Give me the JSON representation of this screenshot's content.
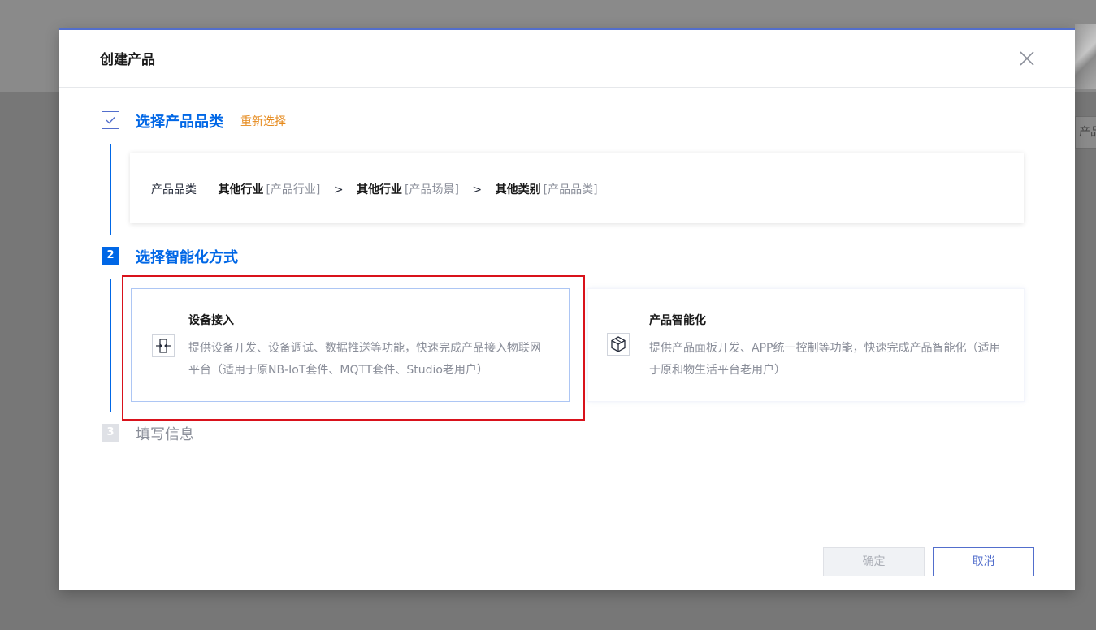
{
  "background": {
    "top_text": "",
    "right_tab_label": "产品"
  },
  "modal": {
    "title": "创建产品"
  },
  "steps": [
    {
      "number": "✓",
      "title": "选择产品品类",
      "status": "done"
    },
    {
      "number": "2",
      "title": "选择智能化方式",
      "status": "active"
    },
    {
      "number": "3",
      "title": "填写信息",
      "status": "pending"
    }
  ],
  "reselect_label": "重新选择",
  "category": {
    "label": "产品品类",
    "separator": ">",
    "path": [
      {
        "name": "其他行业",
        "hint": "[产品行业]"
      },
      {
        "name": "其他行业",
        "hint": "[产品场景]"
      },
      {
        "name": "其他类别",
        "hint": "[产品品类]"
      }
    ]
  },
  "options": [
    {
      "title": "设备接入",
      "description": "提供设备开发、设备调试、数据推送等功能，快速完成产品接入物联网平台（适用于原NB-IoT套件、MQTT套件、Studio老用户）",
      "icon": "device-access-icon",
      "selected": true
    },
    {
      "title": "产品智能化",
      "description": "提供产品面板开发、APP统一控制等功能，快速完成产品智能化（适用于原和物生活平台老用户）",
      "icon": "cube-icon",
      "selected": false
    }
  ],
  "buttons": {
    "confirm": "确定",
    "cancel": "取消"
  },
  "colors": {
    "primary": "#0067e6",
    "accent_link": "#e6891b",
    "highlight": "#d9121b",
    "muted": "#8a8e99"
  }
}
